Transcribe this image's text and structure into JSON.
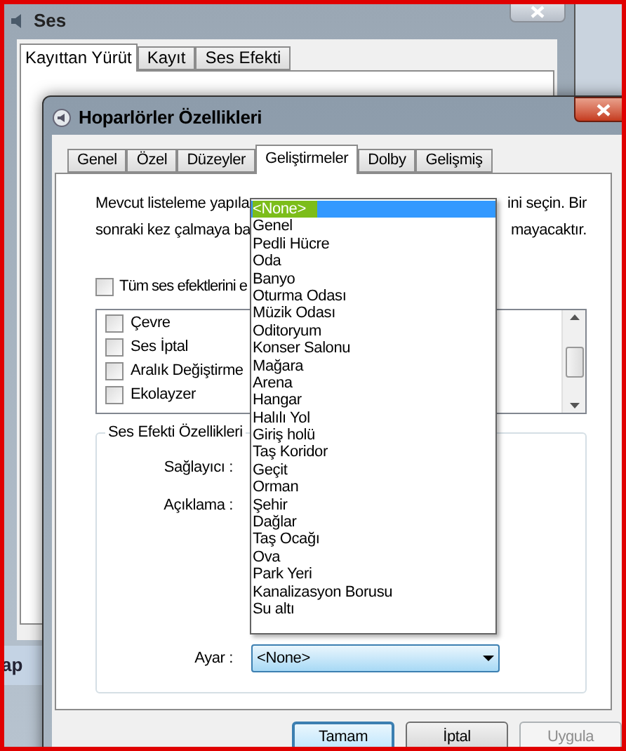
{
  "background_window": {
    "title": "Ses",
    "tabs": [
      {
        "label": "Kayıttan Yürüt",
        "selected": true
      },
      {
        "label": "Kayıt",
        "selected": false
      },
      {
        "label": "Ses Efekti",
        "selected": false
      }
    ],
    "taskbar_fragment": "ap"
  },
  "dialog": {
    "title": "Hoparlörler Özellikleri",
    "tabs": [
      {
        "label": "Genel",
        "selected": false
      },
      {
        "label": "Özel",
        "selected": false
      },
      {
        "label": "Düzeyler",
        "selected": false
      },
      {
        "label": "Geliştirmeler",
        "selected": true
      },
      {
        "label": "Dolby",
        "selected": false
      },
      {
        "label": "Gelişmiş",
        "selected": false
      }
    ],
    "description_lines": [
      {
        "left": "Mevcut listeleme yapıla",
        "right": "ini seçin. Bir"
      },
      {
        "left": "sonraki kez çalmaya ba",
        "right": "mayacaktır."
      }
    ],
    "disable_all": {
      "label": "Tüm ses efektlerini e",
      "checked": false
    },
    "effects": [
      {
        "label": "Çevre",
        "checked": false
      },
      {
        "label": "Ses İptal",
        "checked": false
      },
      {
        "label": "Aralık Değiştirme",
        "checked": false
      },
      {
        "label": "Ekolayzer",
        "checked": false
      }
    ],
    "group": {
      "title": "Ses Efekti Özellikleri",
      "provider_label": "Sağlayıcı :",
      "description_label": "Açıklama :",
      "setting_label": "Ayar :",
      "setting_value": "<None>",
      "dropdown": [
        {
          "label": "<None>",
          "selected": true
        },
        {
          "label": "Genel",
          "selected": false
        },
        {
          "label": "Pedli Hücre",
          "selected": false
        },
        {
          "label": "Oda",
          "selected": false
        },
        {
          "label": "Banyo",
          "selected": false
        },
        {
          "label": "Oturma Odası",
          "selected": false
        },
        {
          "label": "Müzik Odası",
          "selected": false
        },
        {
          "label": "Oditoryum",
          "selected": false
        },
        {
          "label": "Konser Salonu",
          "selected": false
        },
        {
          "label": "Mağara",
          "selected": false
        },
        {
          "label": "Arena",
          "selected": false
        },
        {
          "label": "Hangar",
          "selected": false
        },
        {
          "label": "Halılı Yol",
          "selected": false
        },
        {
          "label": "Giriş holü",
          "selected": false
        },
        {
          "label": "Taş Koridor",
          "selected": false
        },
        {
          "label": "Geçit",
          "selected": false
        },
        {
          "label": "Orman",
          "selected": false
        },
        {
          "label": "Şehir",
          "selected": false
        },
        {
          "label": "Dağlar",
          "selected": false
        },
        {
          "label": "Taş Ocağı",
          "selected": false
        },
        {
          "label": "Ova",
          "selected": false
        },
        {
          "label": "Park Yeri",
          "selected": false
        },
        {
          "label": "Kanalizasyon Borusu",
          "selected": false
        },
        {
          "label": "Su altı",
          "selected": false
        }
      ]
    },
    "buttons": [
      {
        "label": "Tamam",
        "kind": "default"
      },
      {
        "label": "İptal",
        "kind": "normal"
      },
      {
        "label": "Uygula",
        "kind": "disabled"
      }
    ]
  }
}
